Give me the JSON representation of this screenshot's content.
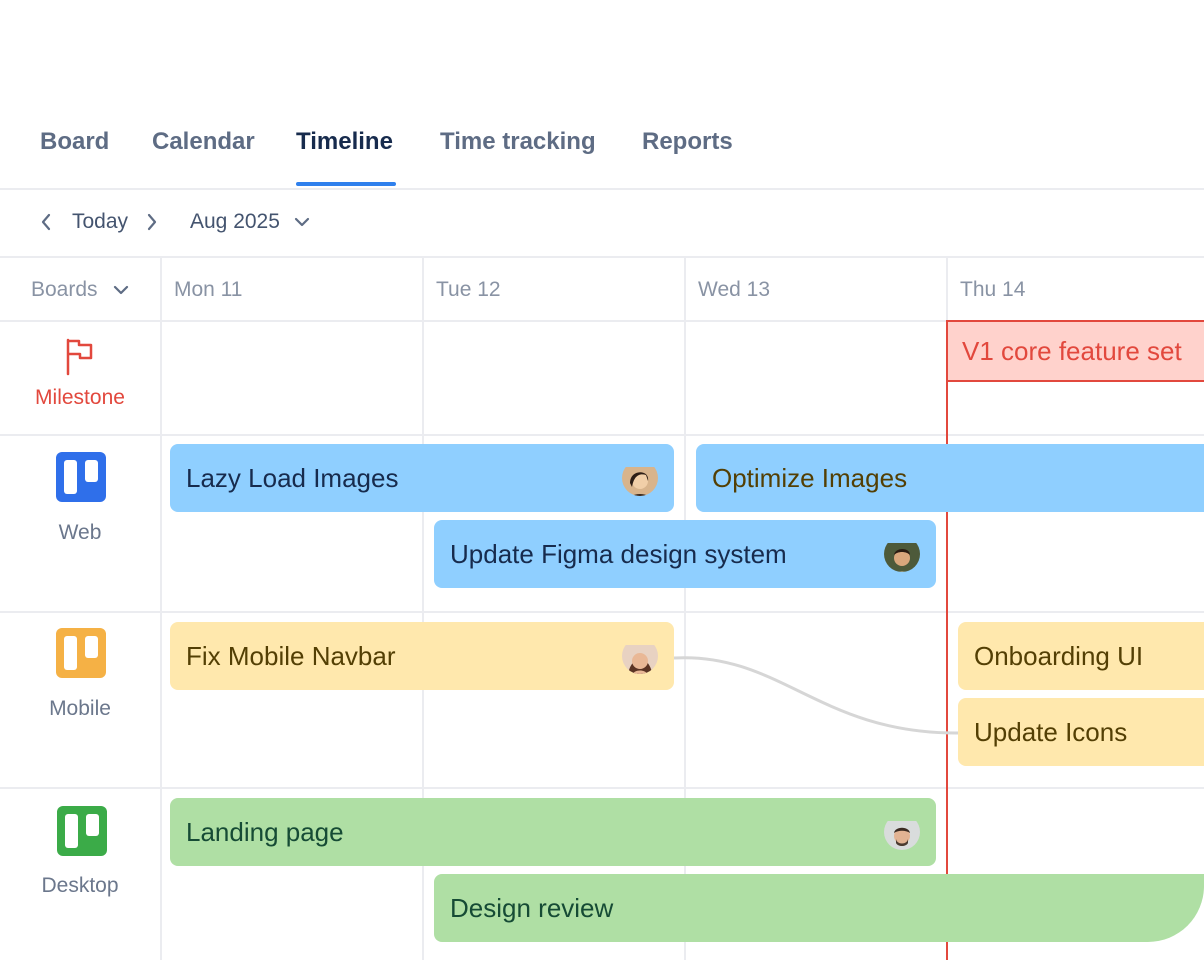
{
  "tabs": {
    "board": "Board",
    "calendar": "Calendar",
    "timeline": "Timeline",
    "time_tracking": "Time tracking",
    "reports": "Reports",
    "active": "Timeline"
  },
  "toolbar": {
    "today": "Today",
    "period": "Aug 2025",
    "icons": [
      "chevron-left-icon",
      "chevron-right-icon",
      "chevron-down-icon"
    ]
  },
  "grid": {
    "boards_label": "Boards",
    "columns": [
      "Mon 11",
      "Tue 12",
      "Wed 13",
      "Thu 14"
    ]
  },
  "rows": {
    "milestone": {
      "label": "Milestone",
      "icon": "flag-icon",
      "color": "#e2483d"
    },
    "web": {
      "label": "Web",
      "icon": "board-icon",
      "color": "#2f6fea"
    },
    "mobile": {
      "label": "Mobile",
      "icon": "board-icon",
      "color": "#f5b145"
    },
    "desktop": {
      "label": "Desktop",
      "icon": "board-icon",
      "color": "#3bab48"
    }
  },
  "milestone": {
    "title": "V1 core feature set"
  },
  "cards": {
    "lazy_load": {
      "title": "Lazy Load Images",
      "color": "#8fcfff"
    },
    "optimize": {
      "title": "Optimize Images",
      "color": "#8fcfff"
    },
    "figma": {
      "title": "Update Figma design system",
      "color": "#8fcfff"
    },
    "navbar": {
      "title": "Fix Mobile Navbar",
      "color": "#ffe8ad"
    },
    "onboarding": {
      "title": "Onboarding UI",
      "color": "#ffe8ad"
    },
    "icons": {
      "title": "Update Icons",
      "color": "#ffe8ad"
    },
    "landing": {
      "title": "Landing page",
      "color": "#afdfa4"
    },
    "review": {
      "title": "Design review",
      "color": "#afdfa4"
    }
  }
}
